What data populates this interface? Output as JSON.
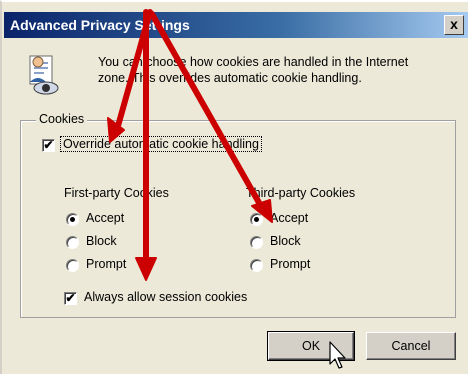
{
  "window": {
    "title": "Advanced Privacy Settings",
    "close_label": "x"
  },
  "info": {
    "line1": "You can choose how cookies are handled in the Internet",
    "line2": "zone. This overrides automatic cookie handling."
  },
  "cookies_group": {
    "legend": "Cookies",
    "override_label": "Override automatic cookie handling",
    "override_checked": true,
    "first_party": {
      "title": "First-party Cookies",
      "options": [
        "Accept",
        "Block",
        "Prompt"
      ],
      "selected": "Accept"
    },
    "third_party": {
      "title": "Third-party Cookies",
      "options": [
        "Accept",
        "Block",
        "Prompt"
      ],
      "selected": "Accept"
    },
    "session_label": "Always allow session cookies",
    "session_checked": true
  },
  "buttons": {
    "ok": "OK",
    "cancel": "Cancel"
  },
  "colors": {
    "annotation_arrow": "#cc0000",
    "titlebar": "#0a246a",
    "dialog_bg": "#ece9d8"
  },
  "icons": [
    "privacy-document-icon",
    "close-icon",
    "mouse-cursor-icon",
    "annotation-arrow"
  ]
}
